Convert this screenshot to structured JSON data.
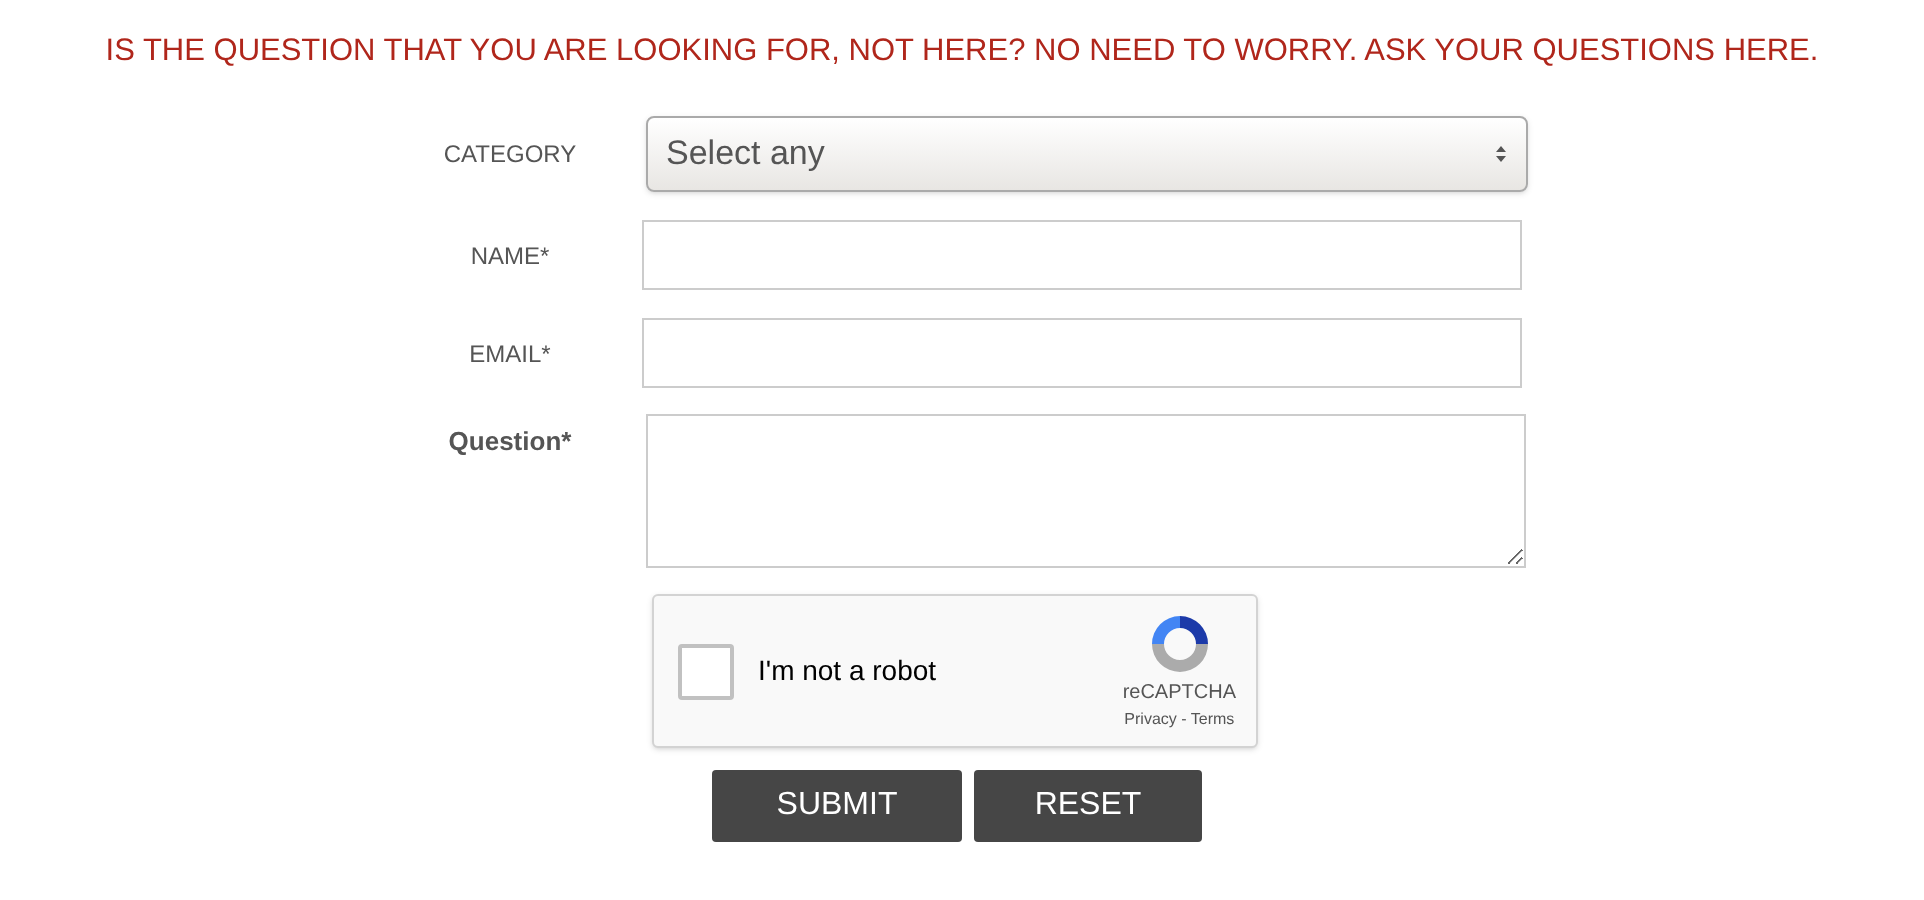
{
  "heading": "IS THE QUESTION THAT YOU ARE LOOKING FOR, NOT HERE? NO NEED TO WORRY. ASK YOUR QUESTIONS HERE.",
  "fields": [
    {
      "kind": "select",
      "label": "CATEGORY",
      "value": "Select any"
    },
    {
      "kind": "text",
      "label": "NAME*"
    },
    {
      "kind": "text",
      "label": "EMAIL*"
    },
    {
      "kind": "textarea",
      "label": "Question*"
    }
  ],
  "captcha": {
    "label": "I'm not a robot",
    "checked": false,
    "brand": "reCAPTCHA",
    "links": "Privacy - Terms"
  },
  "buttons": [
    "SUBMIT",
    "RESET"
  ]
}
